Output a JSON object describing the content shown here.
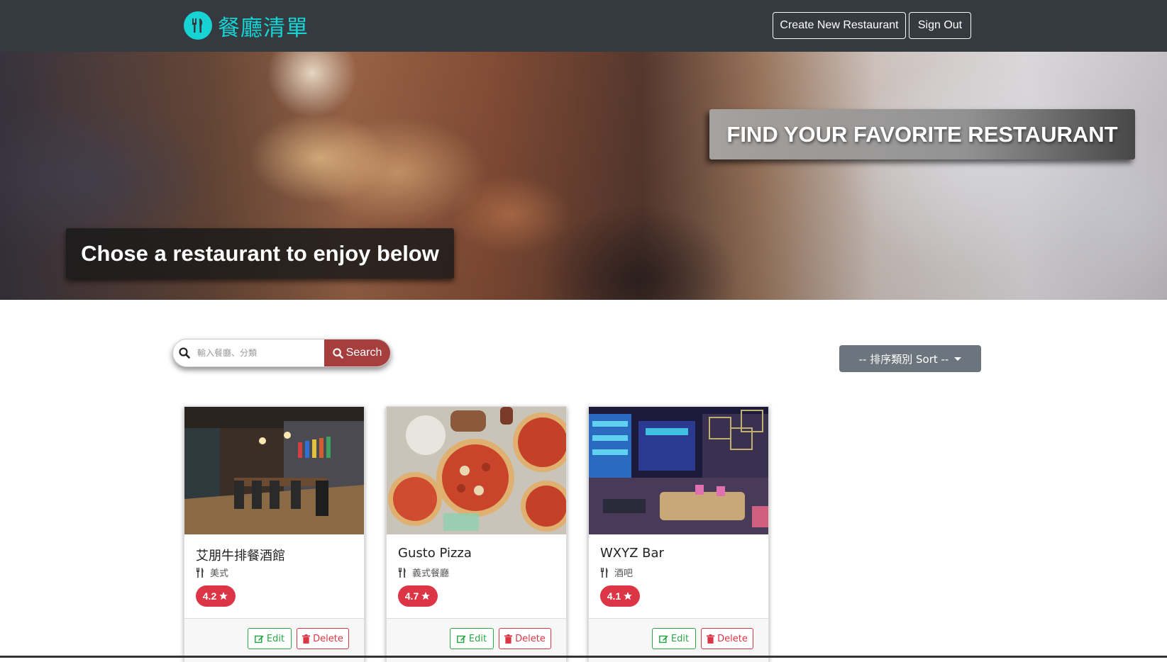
{
  "brand": {
    "name": "餐廳清單",
    "logo_icon": "utensils-icon",
    "color": "#17d3d3"
  },
  "nav": {
    "create_label": "Create New Restaurant",
    "signout_label": "Sign Out"
  },
  "hero": {
    "right_text": "FIND YOUR FAVORITE RESTAURANT",
    "left_text": "Chose a restaurant to enjoy below"
  },
  "search": {
    "placeholder": "輸入餐廳、分類",
    "button_label": "Search"
  },
  "sort": {
    "label": "-- 排序類別 Sort --"
  },
  "cards": [
    {
      "name": "艾朋牛排餐酒館",
      "category": "美式",
      "rating": "4.2",
      "edit_label": "Edit",
      "delete_label": "Delete"
    },
    {
      "name": "Gusto Pizza",
      "category": "義式餐廳",
      "rating": "4.7",
      "edit_label": "Edit",
      "delete_label": "Delete"
    },
    {
      "name": "WXYZ Bar",
      "category": "酒吧",
      "rating": "4.1",
      "edit_label": "Edit",
      "delete_label": "Delete"
    }
  ],
  "colors": {
    "navbar": "#343a40",
    "search_button": "#a73e3e",
    "rating_badge": "#dc3545",
    "edit": "#28a745",
    "sort_button": "#6c757d"
  }
}
